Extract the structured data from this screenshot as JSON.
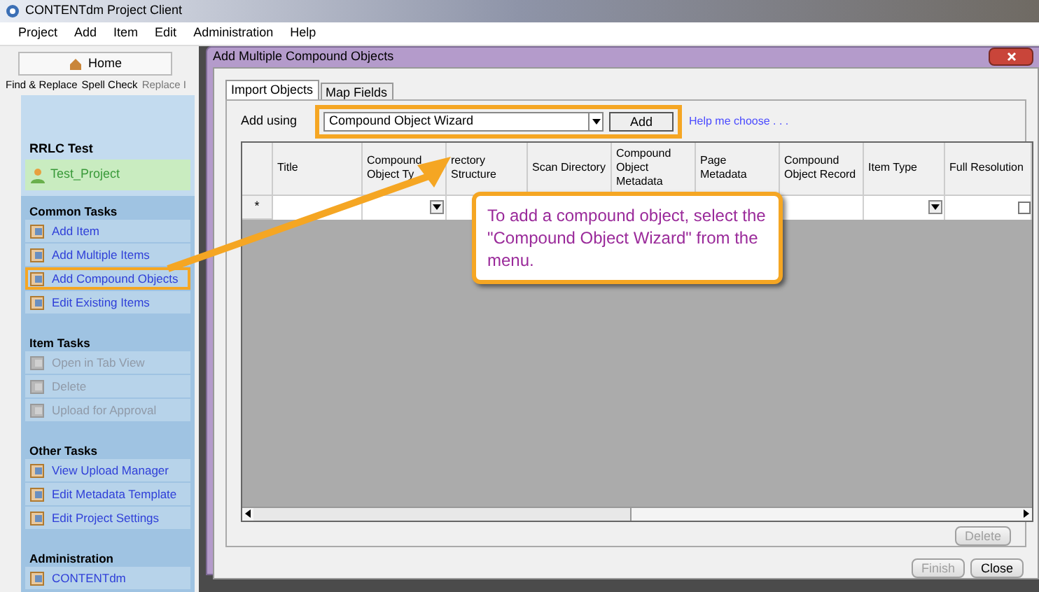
{
  "app": {
    "title": "CONTENTdm Project Client",
    "menu": [
      "Project",
      "Add",
      "Item",
      "Edit",
      "Administration",
      "Help"
    ],
    "home_tab": "Home",
    "toolbar": [
      "Find & Replace",
      "Spell Check",
      "Replace I"
    ],
    "project": {
      "name": "RRLC Test",
      "current": "Test_Project"
    },
    "sections": [
      {
        "title": "Common Tasks",
        "items": [
          {
            "label": "Add Item",
            "disabled": false,
            "highlighted": false
          },
          {
            "label": "Add Multiple Items",
            "disabled": false,
            "highlighted": false
          },
          {
            "label": "Add Compound Objects",
            "disabled": false,
            "highlighted": true
          },
          {
            "label": "Edit Existing Items",
            "disabled": false,
            "highlighted": false
          }
        ]
      },
      {
        "title": "Item Tasks",
        "items": [
          {
            "label": "Open in Tab View",
            "disabled": true,
            "highlighted": false
          },
          {
            "label": "Delete",
            "disabled": true,
            "highlighted": false
          },
          {
            "label": "Upload for Approval",
            "disabled": true,
            "highlighted": false
          }
        ]
      },
      {
        "title": "Other Tasks",
        "items": [
          {
            "label": "View Upload Manager",
            "disabled": false,
            "highlighted": false
          },
          {
            "label": "Edit Metadata Template",
            "disabled": false,
            "highlighted": false
          },
          {
            "label": "Edit Project Settings",
            "disabled": false,
            "highlighted": false
          }
        ]
      },
      {
        "title": "Administration",
        "items": [
          {
            "label": "CONTENTdm",
            "disabled": false,
            "highlighted": false
          }
        ]
      }
    ]
  },
  "dialog": {
    "title": "Add Multiple Compound Objects",
    "tabs": [
      {
        "label": "Import Objects",
        "selected": true
      },
      {
        "label": "Map Fields",
        "selected": false
      }
    ],
    "add_using": {
      "label": "Add using",
      "value": "Compound Object Wizard",
      "button": "Add",
      "highlighted": true
    },
    "help_link": "Help me choose . . .",
    "grid": {
      "row_marker": "*",
      "columns": [
        {
          "label": "Title",
          "kind": "text"
        },
        {
          "label": "Compound Object Ty",
          "kind": "dropdown"
        },
        {
          "label": "rectory Structure",
          "kind": "text"
        },
        {
          "label": "Scan Directory",
          "kind": "text"
        },
        {
          "label": "Compound Object Metadata",
          "kind": "text"
        },
        {
          "label": "Page Metadata",
          "kind": "text"
        },
        {
          "label": "Compound Object Record",
          "kind": "text"
        },
        {
          "label": "Item Type",
          "kind": "dropdown"
        },
        {
          "label": "Full Resolution",
          "kind": "checkbox"
        }
      ],
      "new_row": {
        "full_resolution_checked": false
      }
    },
    "delete_button": {
      "label": "Delete",
      "disabled": true
    },
    "footer_buttons": [
      {
        "label": "Finish",
        "disabled": true
      },
      {
        "label": "Close",
        "disabled": false
      }
    ]
  },
  "callout": {
    "text": "To add a compound object, select the \"Compound Object Wizard\" from the menu."
  }
}
